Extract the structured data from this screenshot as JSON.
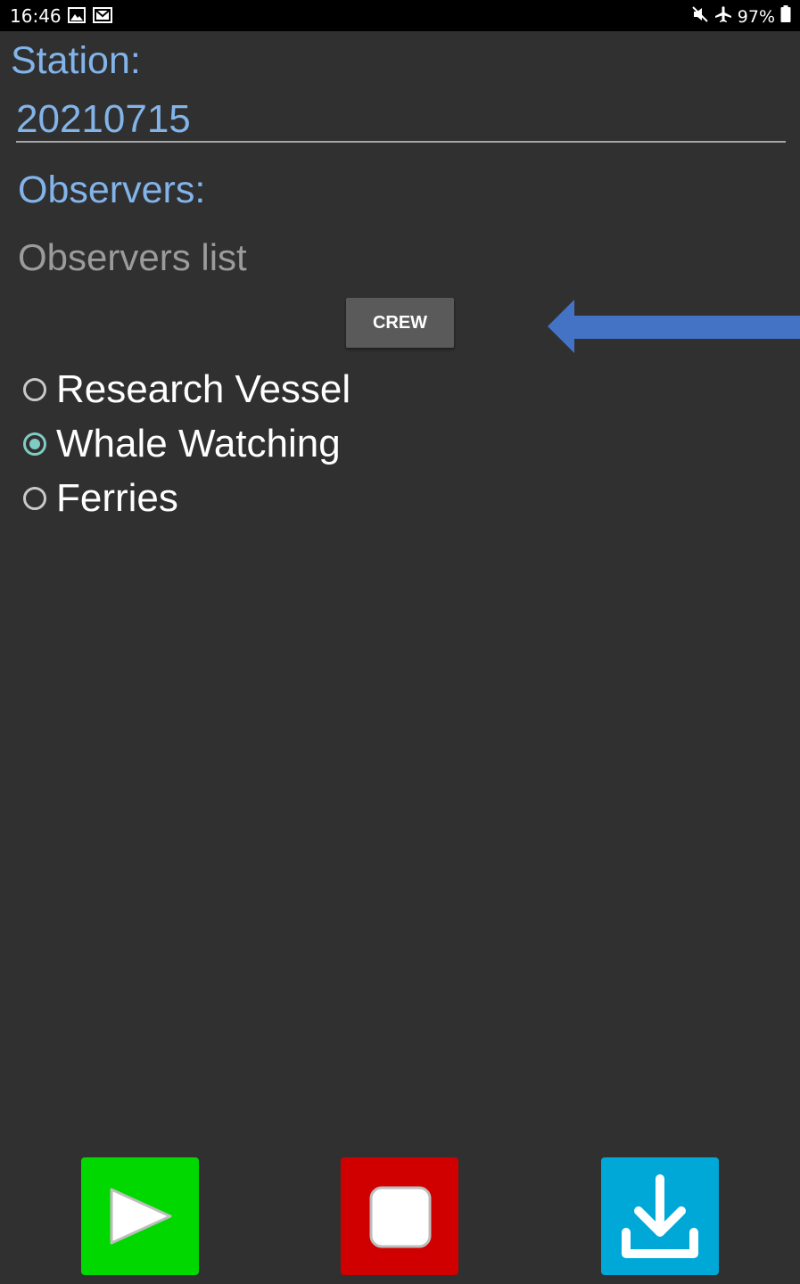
{
  "status_bar": {
    "time": "16:46",
    "left_icons": [
      "gallery-icon",
      "mail-icon"
    ],
    "right_icons": [
      "mute-icon",
      "airplane-icon",
      "battery-icon"
    ],
    "battery": "97%"
  },
  "station": {
    "label": "Station:",
    "value": "20210715"
  },
  "observers": {
    "label": "Observers:",
    "placeholder": "Observers list"
  },
  "crew_button": {
    "label": "CREW"
  },
  "vessel_options": {
    "selected": "Whale Watching",
    "items": [
      {
        "label": "Research Vessel",
        "checked": false
      },
      {
        "label": "Whale Watching",
        "checked": true
      },
      {
        "label": "Ferries",
        "checked": false
      }
    ]
  },
  "toolbar": {
    "buttons": [
      {
        "name": "play",
        "icon": "play-icon",
        "color": "#00d800"
      },
      {
        "name": "stop",
        "icon": "stop-icon",
        "color": "#d00000"
      },
      {
        "name": "download",
        "icon": "download-icon",
        "color": "#00a8d8"
      }
    ]
  },
  "colors": {
    "background": "#303030",
    "accent_text": "#82b4ea",
    "radio_checked": "#80cbc4",
    "arrow": "#4472c4"
  }
}
